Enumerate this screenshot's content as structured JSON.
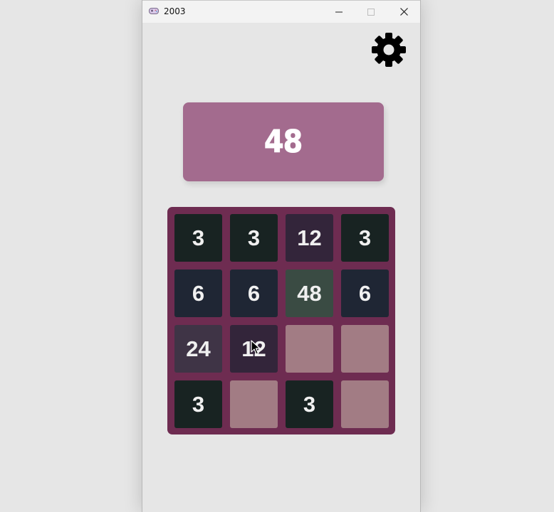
{
  "window": {
    "title": "2003",
    "app_icon": "game-controller-icon",
    "controls": [
      "minimize-icon",
      "maximize-icon",
      "close-icon"
    ]
  },
  "settings": {
    "icon": "gear-icon"
  },
  "score": {
    "value": "48",
    "color": "#a36b8e"
  },
  "board": {
    "color": "#6e2c51",
    "empty_color": "#a27c84",
    "rows": [
      [
        {
          "value": "3",
          "color": "#182322"
        },
        {
          "value": "3",
          "color": "#182322"
        },
        {
          "value": "12",
          "color": "#33253a"
        },
        {
          "value": "3",
          "color": "#182322"
        }
      ],
      [
        {
          "value": "6",
          "color": "#1f2634"
        },
        {
          "value": "6",
          "color": "#1f2634"
        },
        {
          "value": "48",
          "color": "#3a4b43"
        },
        {
          "value": "6",
          "color": "#1f2634"
        }
      ],
      [
        {
          "value": "24",
          "color": "#3f3446"
        },
        {
          "value": "12",
          "color": "#33253a"
        },
        {
          "value": "",
          "color": "#a27c84"
        },
        {
          "value": "",
          "color": "#a27c84"
        }
      ],
      [
        {
          "value": "3",
          "color": "#182322"
        },
        {
          "value": "",
          "color": "#a27c84"
        },
        {
          "value": "3",
          "color": "#182322"
        },
        {
          "value": "",
          "color": "#a27c84"
        }
      ]
    ]
  }
}
